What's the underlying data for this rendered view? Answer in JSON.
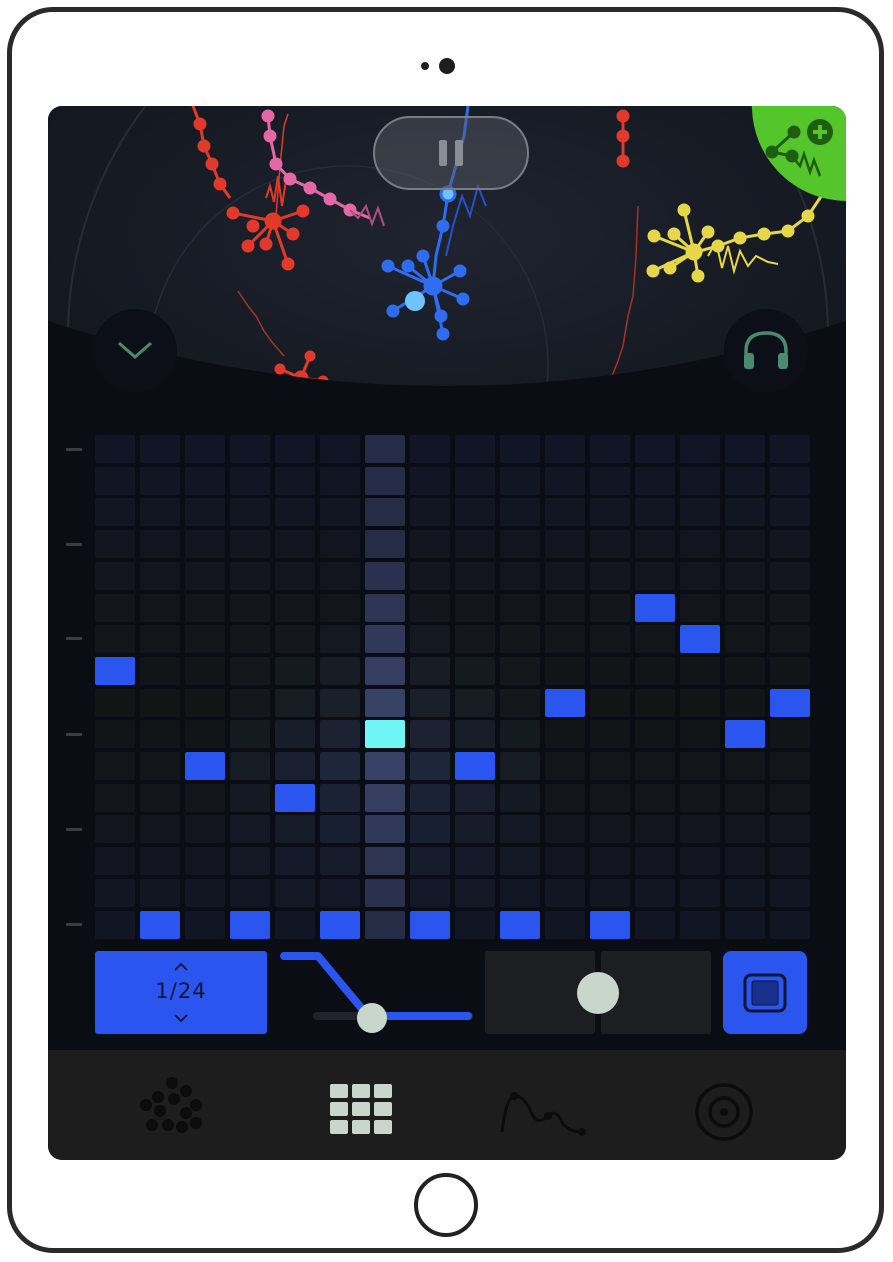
{
  "app": {
    "clock_division": "1/24",
    "transport_state": "paused",
    "icons": {
      "pause": "pause-icon",
      "add_instrument": "add-network-icon",
      "collapse": "chevron-down-icon",
      "monitor": "headphones-icon",
      "rate_up": "chevron-up-icon",
      "rate_down": "chevron-down-icon",
      "stop": "stop-icon"
    },
    "colors": {
      "accent_blue": "#2a55ee",
      "playhead_cyan": "#6ff5f5",
      "add_green": "#54c52b",
      "red_network": "#e23a2a",
      "pink_network": "#e467a6",
      "blue_network": "#2f6cf0",
      "yellow_network": "#e6d74a",
      "headphones_green": "#4a8a6e"
    }
  },
  "sequencer": {
    "columns": 16,
    "rows": 16,
    "playhead_column": 6,
    "active_cells": [
      [
        0,
        7
      ],
      [
        1,
        15
      ],
      [
        2,
        10
      ],
      [
        3,
        15
      ],
      [
        4,
        11
      ],
      [
        5,
        15
      ],
      [
        6,
        9
      ],
      [
        7,
        15
      ],
      [
        8,
        10
      ],
      [
        9,
        15
      ],
      [
        10,
        8
      ],
      [
        11,
        15
      ],
      [
        12,
        5
      ],
      [
        13,
        6
      ],
      [
        14,
        9
      ],
      [
        15,
        8
      ]
    ]
  },
  "controls": {
    "probability_slider": 0.18,
    "xy_pad_x": 0.5,
    "xy_pad_y": 0.5
  },
  "tabbar": {
    "tabs": [
      {
        "icon": "network-dots-icon",
        "active": false
      },
      {
        "icon": "grid-icon",
        "active": true
      },
      {
        "icon": "curve-icon",
        "active": false
      },
      {
        "icon": "record-icon",
        "active": false
      }
    ]
  }
}
